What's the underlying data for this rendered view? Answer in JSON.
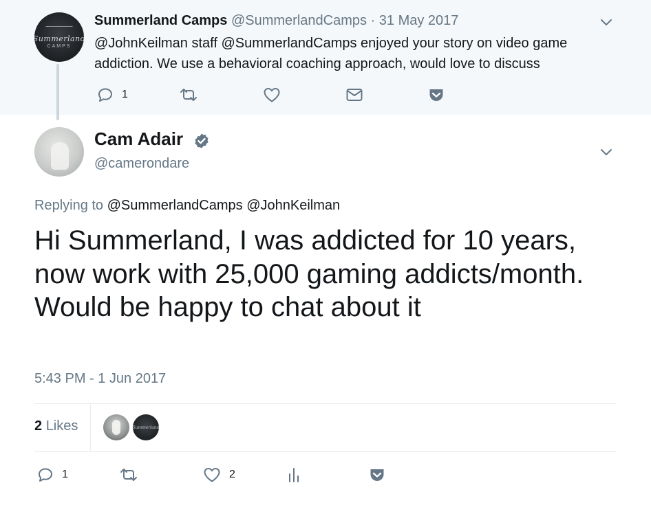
{
  "parent_tweet": {
    "author_name": "Summerland Camps",
    "author_handle": "@SummerlandCamps",
    "separator": "·",
    "date": "31 May 2017",
    "text": "@JohnKeilman staff @SummerlandCamps enjoyed your story on video game addiction. We use a behavioral coaching approach, would love to discuss",
    "avatar_logo_text": "Summerland",
    "avatar_logo_caps": "CAMPS",
    "reply_count": "1"
  },
  "main_tweet": {
    "author_name": "Cam Adair",
    "author_handle": "@camerondare",
    "verified": true,
    "replying_prefix": "Replying to",
    "replying_mentions": "@SummerlandCamps @JohnKeilman",
    "text": "Hi Summerland, I was addicted for 10 years, now work with 25,000 gaming addicts/month. Would be happy to chat about it",
    "timestamp": "5:43 PM - 1 Jun 2017",
    "likes_count": "2",
    "likes_label": "Likes",
    "reply_count": "1",
    "like_count": "2"
  },
  "colors": {
    "parent_background": "#f5f8fa",
    "text_primary": "#14171a",
    "text_secondary": "#657786",
    "verified_blue": "#1da1f2",
    "icon_gray": "#657786"
  },
  "icons": [
    "reply-icon",
    "retweet-icon",
    "like-icon",
    "direct-message-icon",
    "pocket-icon",
    "analytics-icon",
    "chevron-down-icon",
    "verified-badge-icon"
  ]
}
